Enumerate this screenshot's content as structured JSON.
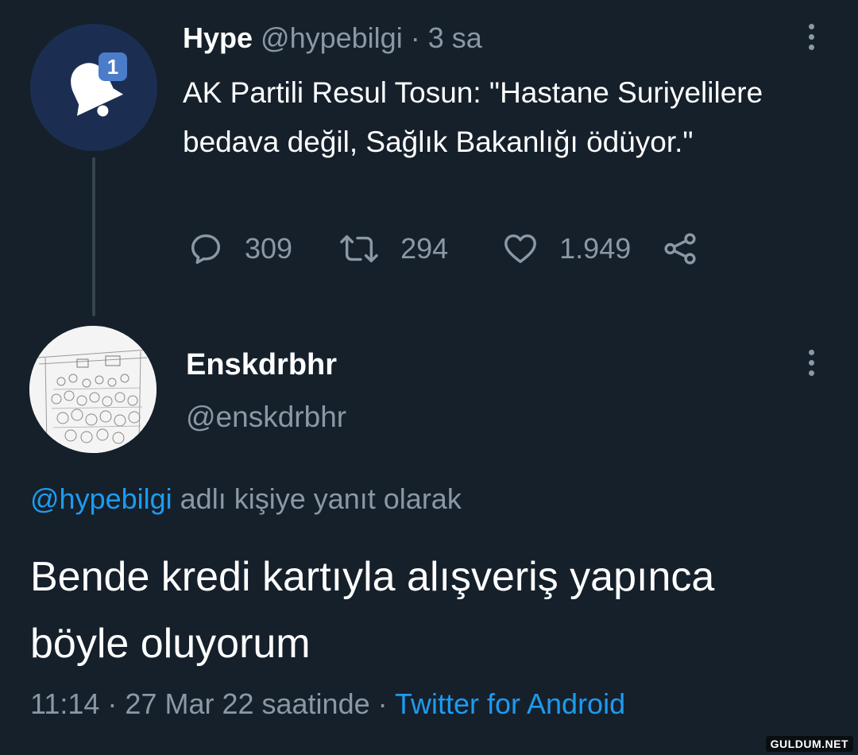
{
  "parent_tweet": {
    "author_name": "Hype",
    "handle": "@hypebilgi",
    "separator": "·",
    "time_ago": "3 sa",
    "notification_badge": "1",
    "avatar_icon": "bell-icon",
    "text": "AK Partili Resul Tosun: \"Hastane Suriyelilere bedava değil, Sağlık Bakanlığı ödüyor.\"",
    "reply_count": "309",
    "retweet_count": "294",
    "like_count": "1.949"
  },
  "reply_tweet": {
    "author_name": "Enskdrbhr",
    "handle": "@enskdrbhr",
    "reply_to_handle": "@hypebilgi",
    "reply_to_suffix": " adlı kişiye yanıt olarak",
    "text": "Bende kredi kartıyla alışveriş yapınca böyle oluyorum",
    "time": "11:14",
    "separator": " · ",
    "date": "27 Mar 22 saatinde",
    "source": "Twitter for Android"
  },
  "watermark": "GULDUM.NET",
  "colors": {
    "background": "#15202b",
    "muted_text": "#8b98a5",
    "link": "#1d9bf0",
    "avatar_bg": "#1b2e52"
  }
}
